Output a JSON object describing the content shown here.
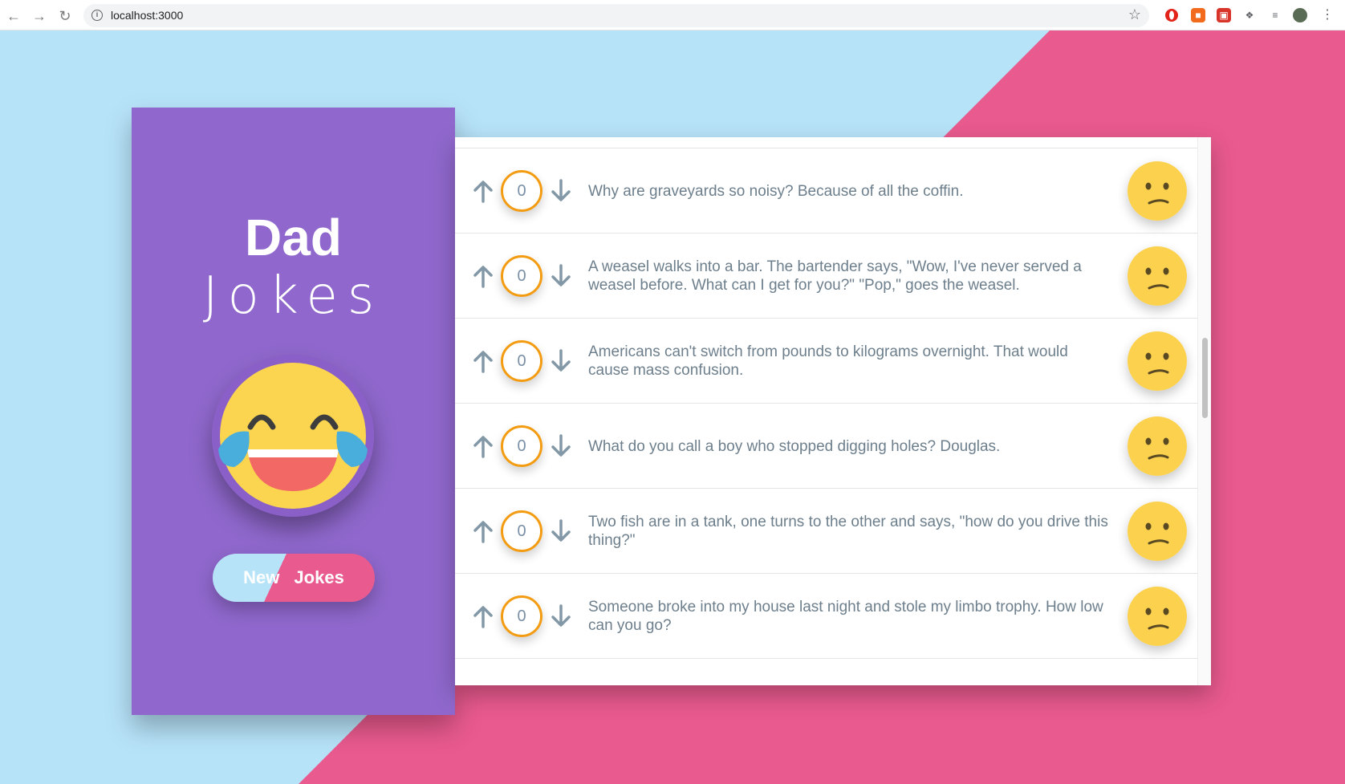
{
  "browser": {
    "url": "localhost:3000",
    "back_icon": "arrow-left-icon",
    "forward_icon": "arrow-right-icon",
    "reload_icon": "reload-icon",
    "bookmark_icon": "star-icon"
  },
  "colors": {
    "bg_blue": "#b7e3f9",
    "bg_pink": "#e95a8e",
    "sidebar": "#9068cd",
    "score_border": "#f39c12",
    "text": "#6d7f8c"
  },
  "sidebar": {
    "title_bold": "Dad",
    "title_light": "Jokes",
    "logo_icon": "laughing-tears-emoji-icon",
    "button_word1": "New",
    "button_word2": "Jokes"
  },
  "jokes": [
    {
      "score": "0",
      "text": "Why are graveyards so noisy? Because of all the coffin.",
      "face_icon": "confused-face-icon"
    },
    {
      "score": "0",
      "text": "A weasel walks into a bar. The bartender says, \"Wow, I've never served a weasel before. What can I get for you?\" \"Pop,\" goes the weasel.",
      "face_icon": "confused-face-icon"
    },
    {
      "score": "0",
      "text": "Americans can't switch from pounds to kilograms overnight. That would cause mass confusion.",
      "face_icon": "confused-face-icon"
    },
    {
      "score": "0",
      "text": "What do you call a boy who stopped digging holes? Douglas.",
      "face_icon": "confused-face-icon"
    },
    {
      "score": "0",
      "text": "Two fish are in a tank, one turns to the other and says, \"how do you drive this thing?\"",
      "face_icon": "confused-face-icon"
    },
    {
      "score": "0",
      "text": "Someone broke into my house last night and stole my limbo trophy. How low can you go?",
      "face_icon": "confused-face-icon"
    }
  ]
}
